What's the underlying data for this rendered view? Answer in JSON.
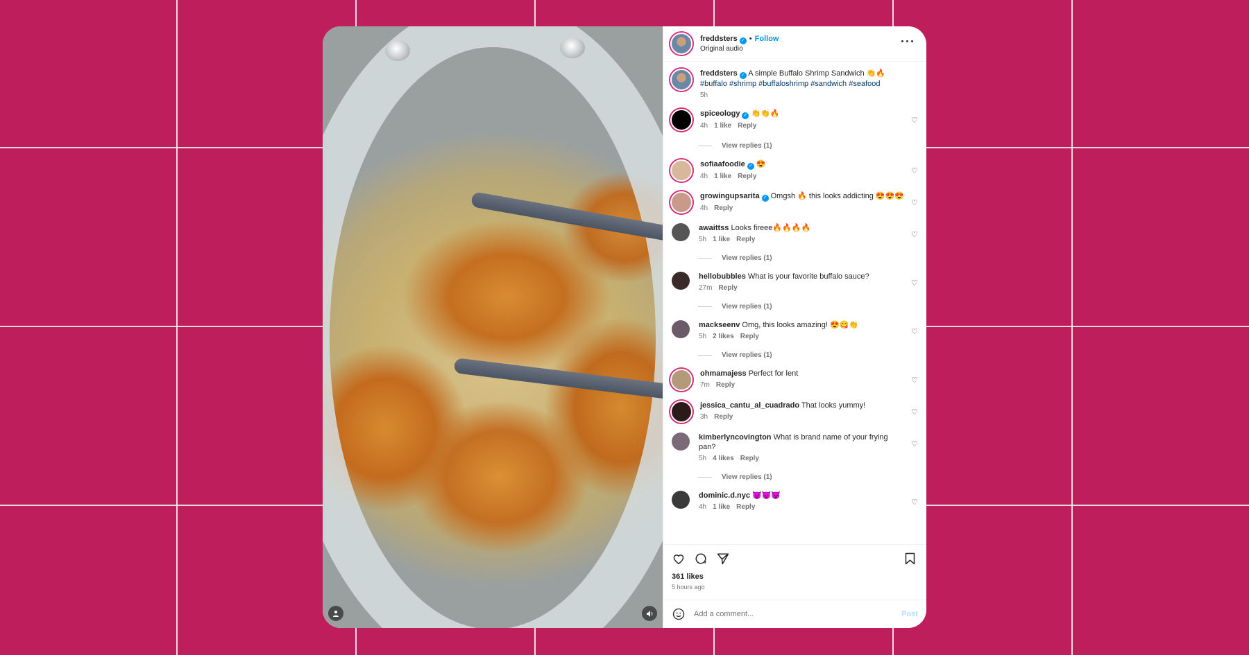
{
  "header": {
    "username": "freddsters",
    "follow_label": "Follow",
    "audio": "Original audio"
  },
  "caption": {
    "username": "freddsters",
    "text": "A simple Buffalo Shrimp Sandwich 👏🔥",
    "tags": "#buffalo #shrimp #buffaloshrimp #sandwich #seafood",
    "time": "5h"
  },
  "comments": [
    {
      "user": "spiceology",
      "text": "👏👏🔥",
      "time": "4h",
      "likes": "1 like",
      "reply": "Reply",
      "view_replies": "View replies (1)"
    },
    {
      "user": "sofiaafoodie",
      "text": "😍",
      "time": "4h",
      "likes": "1 like",
      "reply": "Reply"
    },
    {
      "user": "growingupsarita",
      "text": "Omgsh 🔥 this looks addicting 😍😍😍",
      "time": "4h",
      "reply": "Reply"
    },
    {
      "user": "awaittss",
      "text": "Looks fireee🔥🔥🔥🔥",
      "time": "5h",
      "likes": "1 like",
      "reply": "Reply",
      "view_replies": "View replies (1)"
    },
    {
      "user": "hellobubbles",
      "text": "What is your favorite buffalo sauce?",
      "time": "27m",
      "reply": "Reply",
      "view_replies": "View replies (1)"
    },
    {
      "user": "mackseenv",
      "text": "Omg, this looks amazing! 😍😋👏",
      "time": "5h",
      "likes": "2 likes",
      "reply": "Reply",
      "view_replies": "View replies (1)"
    },
    {
      "user": "ohmamajess",
      "text": "Perfect for lent",
      "time": "7m",
      "reply": "Reply"
    },
    {
      "user": "jessica_cantu_al_cuadrado",
      "text": "That looks yummy!",
      "time": "3h",
      "reply": "Reply"
    },
    {
      "user": "kimberlyncovington",
      "text": "What is brand name of your frying pan?",
      "time": "5h",
      "likes": "4 likes",
      "reply": "Reply",
      "view_replies": "View replies (1)"
    },
    {
      "user": "dominic.d.nyc",
      "text": "😈😈😈",
      "time": "4h",
      "likes": "1 like",
      "reply": "Reply"
    }
  ],
  "footer": {
    "likes": "361 likes",
    "posted": "5 hours ago",
    "comment_placeholder": "Add a comment...",
    "post_label": "Post"
  },
  "colors": {
    "background": "#be1e5c",
    "link": "#0095f6"
  }
}
